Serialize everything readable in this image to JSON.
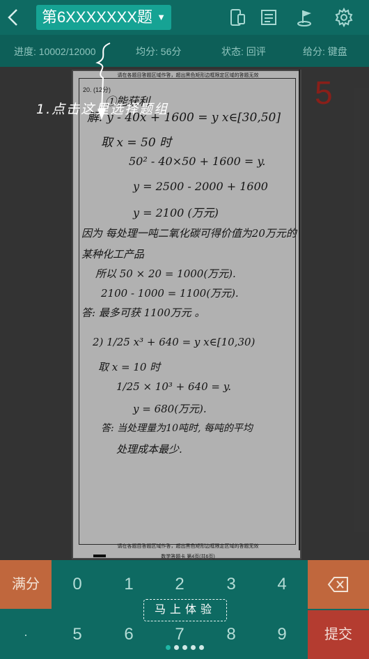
{
  "header": {
    "back_icon": "chevron-left-icon",
    "title": "第6XXXXXXX题",
    "caret": "▼",
    "icons": [
      "device-icon",
      "document-icon",
      "flag-icon",
      "gear-icon"
    ]
  },
  "stats": {
    "progress": "进度: 10002/12000",
    "average": "均分: 56分",
    "status": "状态: 回评",
    "input_mode": "给分: 键盘"
  },
  "paper": {
    "top_notice": "请在各题目答题区域作答，超出黑色矩形边框限定区域的答题无效",
    "question_label": "20. (12分)",
    "bottom_notice": "请在各题目答题区域作答，超出黑色矩形边框限定区域的答题无效",
    "page_footer": "数学答题卡    第4页(共6页)",
    "lines": [
      "①能获利",
      "解: y - 40x + 1600 = y    x∈[30,50]",
      "取 x = 50 时",
      "50² - 40×50 + 1600 = y.",
      "y = 2500 - 2000 + 1600",
      "y = 2100 (万元)",
      "因为 每处理一吨二氧化碳可得价值为20万元的",
      "某种化工产品",
      "所以 50 × 20 = 1000(万元).",
      "2100 - 1000 = 1100(万元).",
      "答: 最多可获 1100万元 。",
      "2) 1/25 x³ + 640 = y  x∈[10,30)",
      "取 x = 10 时",
      "1/25 × 10³ + 640 = y.",
      "y = 680(万元).",
      "答: 当处理量为10吨时, 每吨的平均",
      "处理成本最少."
    ]
  },
  "score": "5",
  "hint": {
    "text": "1.点击这里选择题组"
  },
  "keypad": {
    "full_marks": "满分",
    "dot": "·",
    "submit": "提交",
    "delete_icon": "backspace-icon",
    "digits": [
      "0",
      "1",
      "2",
      "3",
      "4",
      "5",
      "6",
      "7",
      "8",
      "9"
    ],
    "try_now": "马上体验",
    "page_dots": 4,
    "active_dot": 0
  },
  "colors": {
    "primary": "#0e6a62",
    "selector": "#16a394",
    "accent_orange": "#c0673d",
    "submit_red": "#b43c30",
    "score_red": "#a8271f"
  }
}
